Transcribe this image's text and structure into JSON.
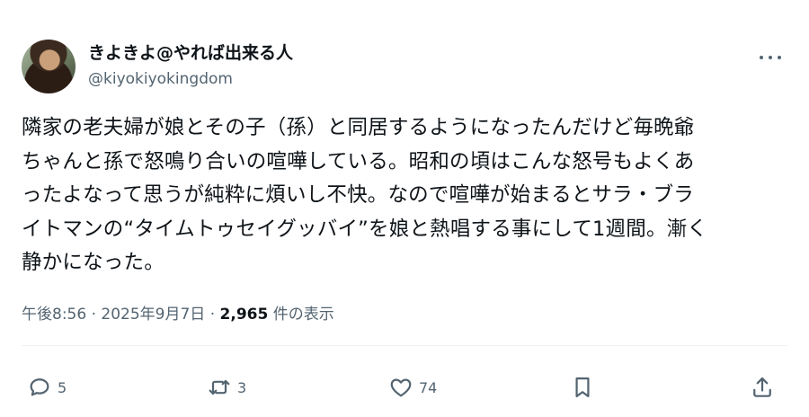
{
  "author": {
    "display_name": "きよきよ@やれば出来る人",
    "handle": "@kiyokiyokingdom",
    "avatar_icon": "avatar-photo"
  },
  "tweet": {
    "text": "隣家の老夫婦が娘とその子（孫）と同居するようになったんだけど毎晩爺\nちゃんと孫で怒鳴り合いの喧嘩している。昭和の頃はこんな怒号もよくあ\nったよなって思うが純粋に煩いし不快。なので喧嘩が始まるとサラ・ブラ\nイトマンの“タイムトゥセイグッバイ”を娘と熱唱する事にして1週間。漸く\n静かになった。"
  },
  "meta": {
    "time": "午後8:56",
    "separator": "·",
    "date": "2025年9月7日",
    "views_count": "2,965",
    "views_label": "件の表示"
  },
  "actions": {
    "reply_count": "5",
    "repost_count": "3",
    "like_count": "74"
  },
  "colors": {
    "text": "#0f1419",
    "secondary": "#536471",
    "divider": "#eff3f4",
    "background": "#ffffff"
  },
  "icons": {
    "more": "more-dots-icon",
    "reply": "reply-bubble-icon",
    "repost": "repost-arrows-icon",
    "like": "heart-icon",
    "bookmark": "bookmark-icon",
    "share": "share-upload-icon"
  }
}
